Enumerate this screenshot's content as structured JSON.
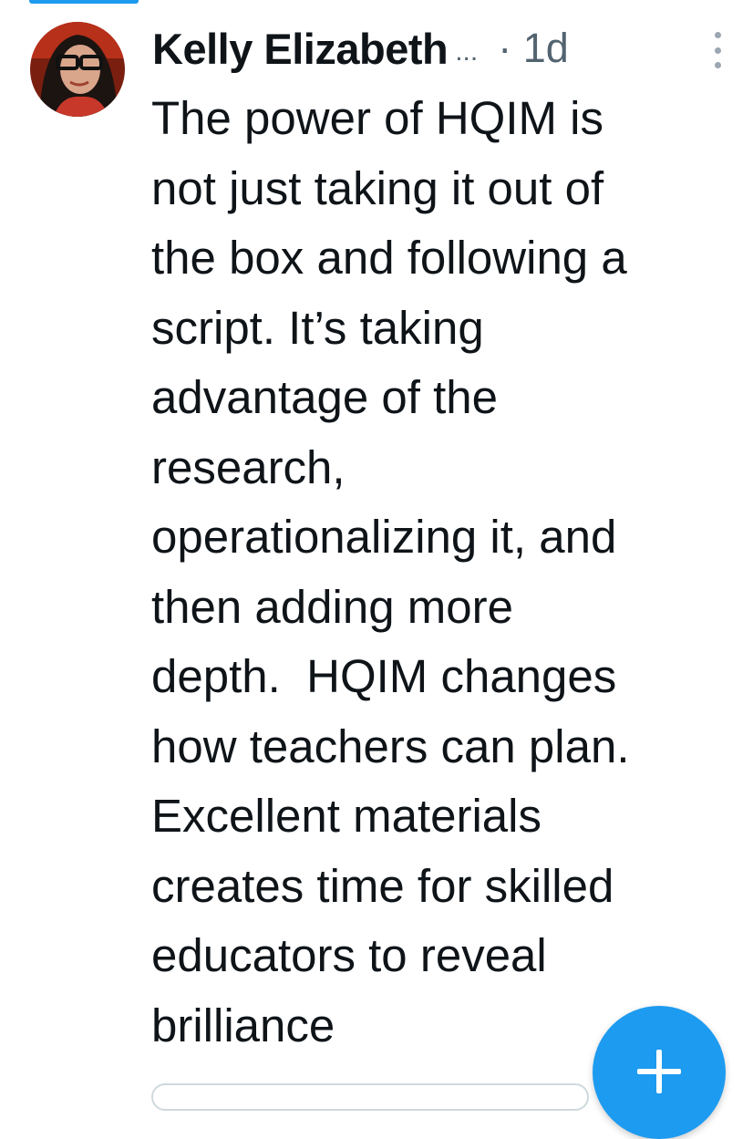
{
  "tweet": {
    "author_name": "Kelly Elizabeth",
    "name_truncation": "...",
    "timestamp": "· 1d",
    "text": "The power of HQIM is\nnot just taking it out of\nthe box and following a\nscript. It’s taking\nadvantage of the\nresearch,\noperationalizing it, and\nthen adding more\ndepth.  HQIM changes\nhow teachers can plan.\nExcellent materials\ncreates time for skilled\neducators to reveal\nbrilliance"
  },
  "icons": {
    "more": "more-vertical-icon",
    "compose": "plus-icon"
  },
  "colors": {
    "accent": "#1d9bf0",
    "text_primary": "#0f1419",
    "text_secondary": "#536471"
  }
}
